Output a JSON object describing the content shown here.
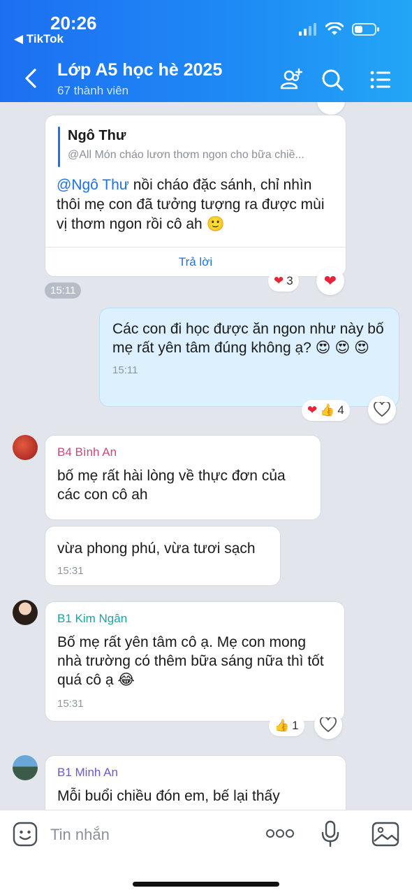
{
  "status_bar": {
    "time": "20:26",
    "back_app": "TikTok"
  },
  "header": {
    "title": "Lớp A5 học hè 2025",
    "subtitle": "67 thành viên"
  },
  "messages": [
    {
      "quote_name": "Ngô Thư",
      "quote_text": "@All Món cháo lươn thơm ngon cho bữa chiề...",
      "mention": "@Ngô Thư",
      "text": " nồi cháo đặc sánh, chỉ nhìn thôi mẹ con đã tưởng tượng ra được mùi vị thơm ngon rồi cô ah 🙂",
      "reply_label": "Trả lời",
      "time": "15:11",
      "reaction_count": "3"
    },
    {
      "text": "Các con đi học được ăn ngon như này bố mẹ rất yên tâm đúng không ạ? 😍 😍 😍",
      "time": "15:11",
      "reaction_count": "4"
    },
    {
      "sender": "B4 Bình An",
      "sender_color": "#c9477d",
      "text": "bố mẹ rất hài lòng về thực đơn của các con cô ah"
    },
    {
      "text": "vừa phong phú, vừa tươi sạch",
      "time": "15:31"
    },
    {
      "sender": "B1 Kim Ngân",
      "sender_color": "#1aa3a0",
      "text": "Bố mẹ rất yên tâm cô ạ. Mẹ con mong nhà trường có thêm bữa sáng nữa thì tốt quá cô ạ 😂",
      "time": "15:31",
      "reaction_count": "1"
    },
    {
      "sender": "B1 Minh An",
      "sender_color": "#6a5acd",
      "text": "Mỗi buổi chiều đón em, bế lại thấy"
    }
  ],
  "input": {
    "placeholder": "Tin nhắn"
  },
  "colors": {
    "header_start": "#1d6ff2",
    "header_end": "#23a6f6",
    "accent": "#1e72e0",
    "own_bubble": "#dcf0fd",
    "heart": "#e8243a"
  }
}
